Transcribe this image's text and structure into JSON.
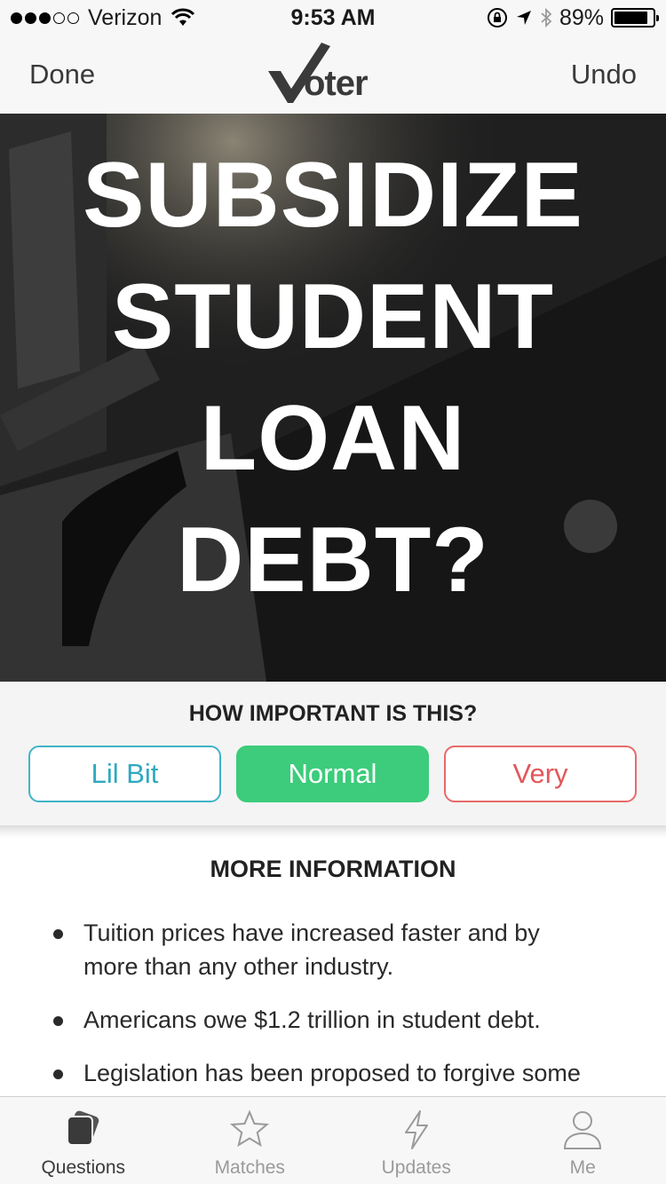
{
  "status_bar": {
    "carrier": "Verizon",
    "time": "9:53 AM",
    "battery": "89%",
    "battery_level": 0.89
  },
  "nav": {
    "done_label": "Done",
    "logo_text": "oter",
    "undo_label": "Undo"
  },
  "question": {
    "lines": [
      "SUBSIDIZE",
      "STUDENT",
      "LOAN",
      "DEBT?"
    ]
  },
  "importance": {
    "title": "HOW IMPORTANT IS THIS?",
    "options": [
      "Lil Bit",
      "Normal",
      "Very"
    ],
    "selected": "Normal",
    "colors": {
      "lil_bit": "#3fb3c9",
      "normal": "#3ccc7b",
      "very": "#e86a6a"
    }
  },
  "more_info": {
    "title": "MORE INFORMATION",
    "items": [
      "Tuition prices have increased faster and by more than any other industry.",
      "Americans owe $1.2 trillion in student debt.",
      "Legislation has been proposed to forgive some federal debt."
    ]
  },
  "tabs": [
    {
      "label": "Questions",
      "icon": "questions-icon",
      "active": true
    },
    {
      "label": "Matches",
      "icon": "star-icon",
      "active": false
    },
    {
      "label": "Updates",
      "icon": "lightning-icon",
      "active": false
    },
    {
      "label": "Me",
      "icon": "person-icon",
      "active": false
    }
  ]
}
